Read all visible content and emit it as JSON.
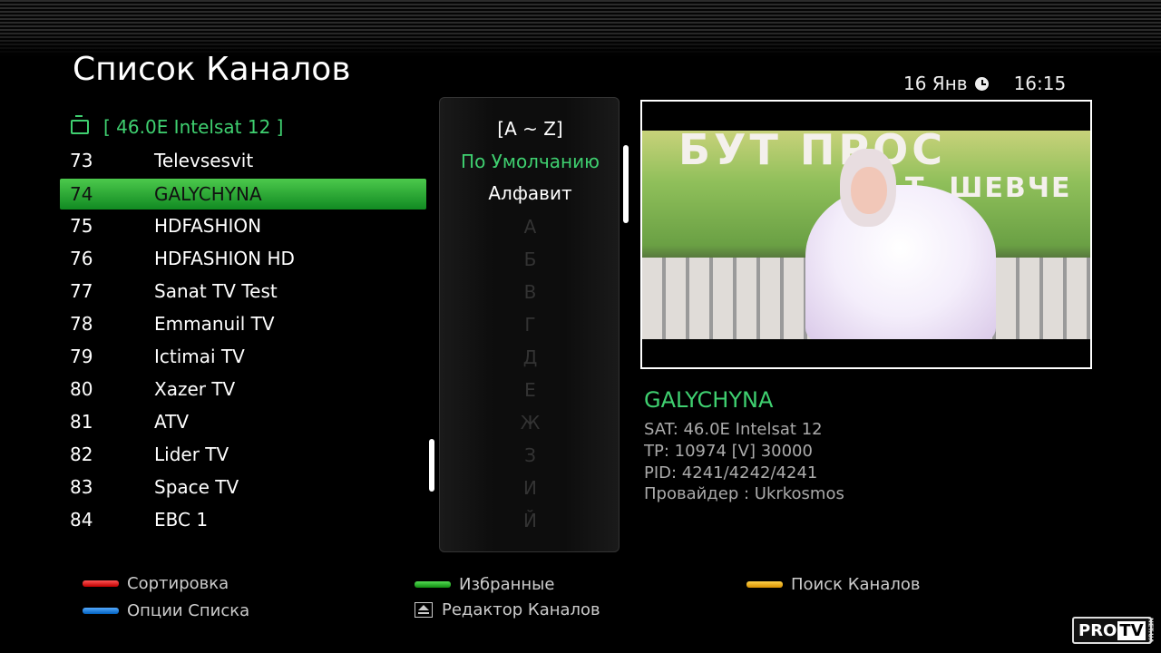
{
  "header": {
    "title": "Список Каналов",
    "date": "16 Янв",
    "time": "16:15"
  },
  "satellite": "[ 46.0E Intelsat 12 ]",
  "channels": [
    {
      "num": "73",
      "name": "Televsesvit"
    },
    {
      "num": "74",
      "name": "GALYCHYNA"
    },
    {
      "num": "75",
      "name": "HDFASHION"
    },
    {
      "num": "76",
      "name": "HDFASHION HD"
    },
    {
      "num": "77",
      "name": "Sanat TV Test"
    },
    {
      "num": "78",
      "name": "Emmanuil TV"
    },
    {
      "num": "79",
      "name": "Ictimai TV"
    },
    {
      "num": "80",
      "name": "Xazer TV"
    },
    {
      "num": "81",
      "name": "ATV"
    },
    {
      "num": "82",
      "name": "Lider TV"
    },
    {
      "num": "83",
      "name": "Space TV"
    },
    {
      "num": "84",
      "name": "EBC 1"
    }
  ],
  "selected_index": 1,
  "sort": {
    "header": "[A ~ Z]",
    "default": "По Умолчанию",
    "alphabet": "Алфавит",
    "letters": [
      "А",
      "Б",
      "В",
      "Г",
      "Д",
      "Е",
      "Ж",
      "З",
      "И",
      "Й"
    ]
  },
  "preview": {
    "banner": "БУТ ПРОС",
    "banner2": "Т. ШЕВЧЕ"
  },
  "info": {
    "channel": "GALYCHYNA",
    "sat": "SAT: 46.0E Intelsat 12",
    "tp": "TP: 10974 [V] 30000",
    "pid": "PID: 4241/4242/4241",
    "provider": "Провайдер : Ukrkosmos"
  },
  "legend": {
    "red": "Сортировка",
    "green": "Избранные",
    "yellow": "Поиск Каналов",
    "blue": "Опции Списка",
    "eject": "Редактор Каналов"
  },
  "colors": {
    "accent_green": "#3fd070",
    "red": "#e02020",
    "green": "#22aa22",
    "yellow": "#f0b020",
    "blue": "#2080e0"
  },
  "logo": {
    "pro": "PRO",
    "tv": "TV",
    "net": "NET.UA"
  }
}
